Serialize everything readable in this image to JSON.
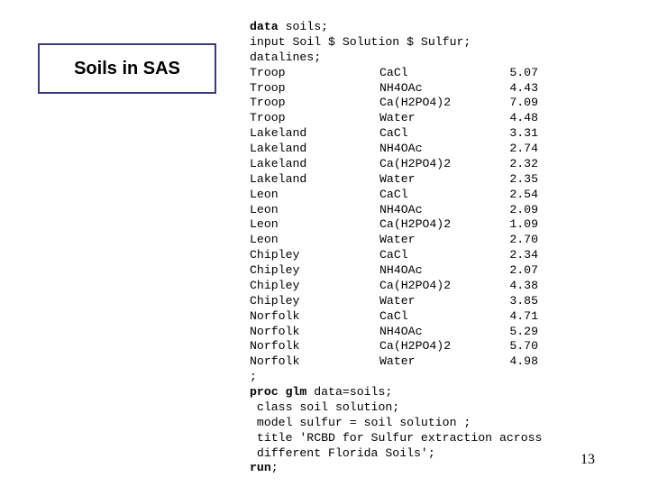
{
  "slide": {
    "title": "Soils in SAS",
    "page_number": "13"
  },
  "code": {
    "data_kw": "data",
    "data_rest": " soils;",
    "input_line": "input Soil $ Solution $ Sulfur;",
    "datalines": "datalines;",
    "rows": [
      {
        "soil": "Troop",
        "solution": "CaCl",
        "sulfur": "5.07"
      },
      {
        "soil": "Troop",
        "solution": "NH4OAc",
        "sulfur": "4.43"
      },
      {
        "soil": "Troop",
        "solution": "Ca(H2PO4)2",
        "sulfur": "7.09"
      },
      {
        "soil": "Troop",
        "solution": "Water",
        "sulfur": "4.48"
      },
      {
        "soil": "Lakeland",
        "solution": "CaCl",
        "sulfur": "3.31"
      },
      {
        "soil": "Lakeland",
        "solution": "NH4OAc",
        "sulfur": "2.74"
      },
      {
        "soil": "Lakeland",
        "solution": "Ca(H2PO4)2",
        "sulfur": "2.32"
      },
      {
        "soil": "Lakeland",
        "solution": "Water",
        "sulfur": "2.35"
      },
      {
        "soil": "Leon",
        "solution": "CaCl",
        "sulfur": "2.54"
      },
      {
        "soil": "Leon",
        "solution": "NH4OAc",
        "sulfur": "2.09"
      },
      {
        "soil": "Leon",
        "solution": "Ca(H2PO4)2",
        "sulfur": "1.09"
      },
      {
        "soil": "Leon",
        "solution": "Water",
        "sulfur": "2.70"
      },
      {
        "soil": "Chipley",
        "solution": "CaCl",
        "sulfur": "2.34"
      },
      {
        "soil": "Chipley",
        "solution": "NH4OAc",
        "sulfur": "2.07"
      },
      {
        "soil": "Chipley",
        "solution": "Ca(H2PO4)2",
        "sulfur": "4.38"
      },
      {
        "soil": "Chipley",
        "solution": "Water",
        "sulfur": "3.85"
      },
      {
        "soil": "Norfolk",
        "solution": "CaCl",
        "sulfur": "4.71"
      },
      {
        "soil": "Norfolk",
        "solution": "NH4OAc",
        "sulfur": "5.29"
      },
      {
        "soil": "Norfolk",
        "solution": "Ca(H2PO4)2",
        "sulfur": "5.70"
      },
      {
        "soil": "Norfolk",
        "solution": "Water",
        "sulfur": "4.98"
      }
    ],
    "semicolon": ";",
    "proc_kw": "proc glm",
    "proc_rest": " data=soils;",
    "class_line": " class soil solution;",
    "model_line": " model sulfur = soil solution ;",
    "title_line1": " title 'RCBD for Sulfur extraction across",
    "title_line2": " different Florida Soils';",
    "run_kw": "run",
    "run_rest": ";"
  }
}
